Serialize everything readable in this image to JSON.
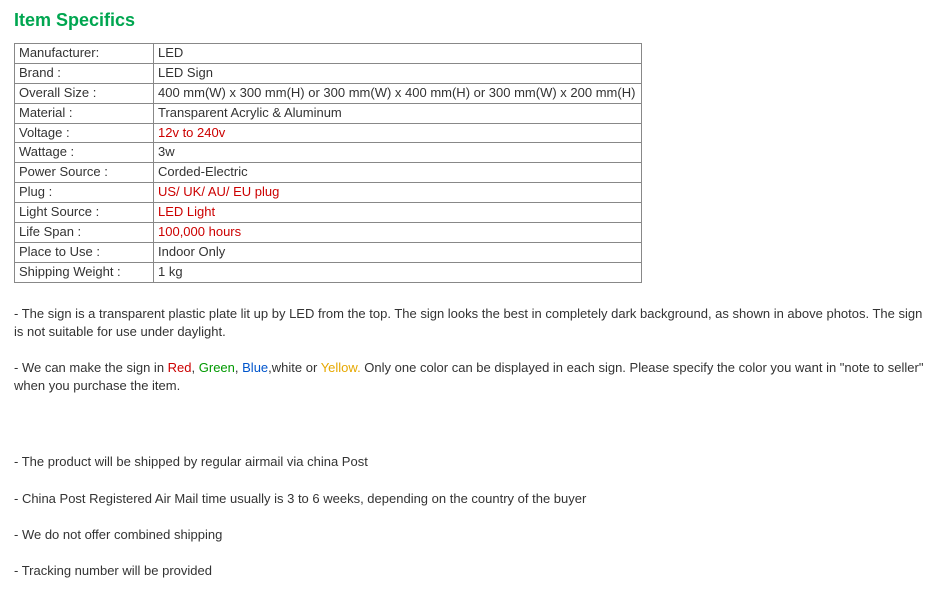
{
  "heading": "Item Specifics",
  "specs": [
    {
      "label": "Manufacturer:",
      "value": "LED",
      "red": false
    },
    {
      "label": "Brand :",
      "value": "LED  Sign",
      "red": false
    },
    {
      "label": "Overall Size :",
      "value": "400 mm(W) x 300 mm(H) or 300 mm(W) x 400 mm(H) or 300 mm(W) x 200 mm(H)",
      "red": false
    },
    {
      "label": "Material :",
      "value": "Transparent Acrylic & Aluminum",
      "red": false
    },
    {
      "label": "Voltage :",
      "value": "12v to 240v",
      "red": true
    },
    {
      "label": "Wattage :",
      "value": "3w",
      "red": false
    },
    {
      "label": "Power Source :",
      "value": "Corded-Electric",
      "red": false
    },
    {
      "label": "Plug :",
      "value": "US/ UK/ AU/ EU plug",
      "red": true
    },
    {
      "label": "Light Source :",
      "value": "LED Light",
      "red": true
    },
    {
      "label": "Life Span :",
      "value": "100,000 hours",
      "red": true
    },
    {
      "label": "Place to Use :",
      "value": "Indoor Only",
      "red": false
    },
    {
      "label": "Shipping Weight :",
      "value": "1 kg",
      "red": false
    }
  ],
  "p1": "- The sign is a transparent plastic plate lit up by LED from the top. The sign looks the best in completely dark background, as shown in above photos. The sign is not suitable for use under daylight.",
  "p2a": "- We can make the sign in ",
  "p2_red": "Red",
  "p2_sep1": ", ",
  "p2_green": "Green",
  "p2_sep2": ", ",
  "p2_blue": "Blue",
  "p2_mid": ",white or ",
  "p2_yellow": "Yellow.",
  "p2b": " Only one color can be displayed in each sign. Please specify the color you want in \"note to seller\" when you purchase the item.",
  "p3": "- The product will be shipped by regular airmail via china Post",
  "p4": "- China Post Registered Air Mail time usually is 3 to 6 weeks, depending on the country of the buyer",
  "p5": "- We do not offer combined shipping",
  "p6": "- Tracking number will be provided"
}
